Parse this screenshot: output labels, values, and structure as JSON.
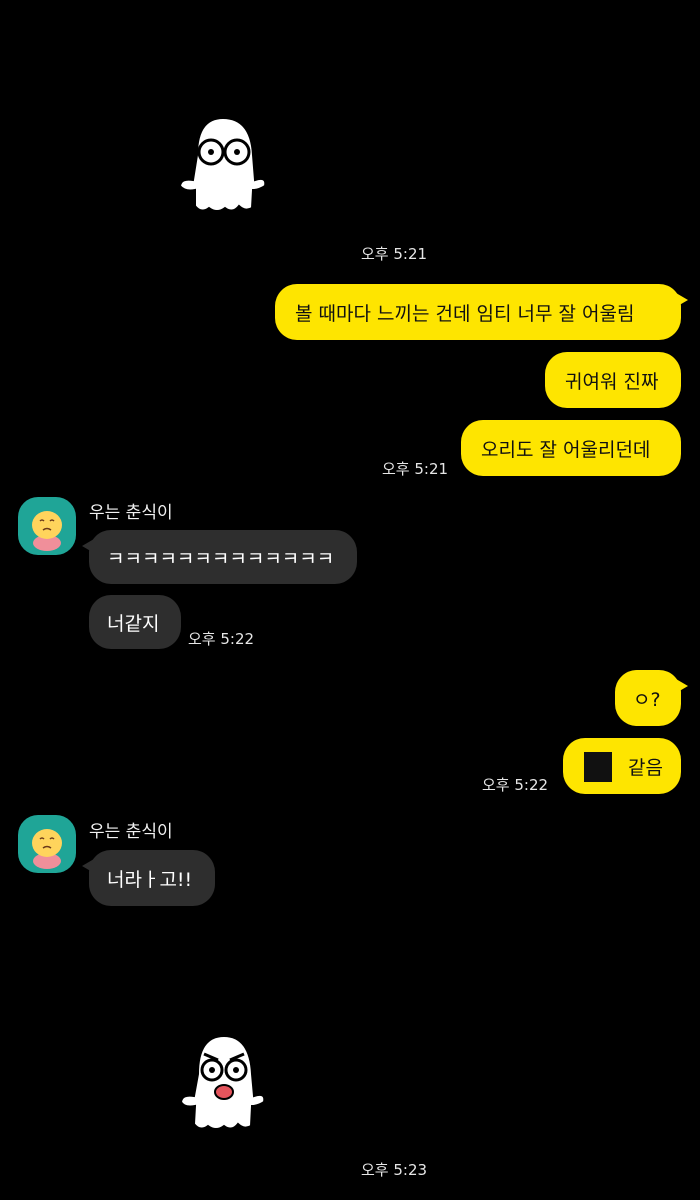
{
  "chat": {
    "contact_name": "우는 춘식이",
    "messages": [
      {
        "side": "me",
        "text": "볼 때마다 느끼는 건데 임티 너무 잘 어울림"
      },
      {
        "side": "me",
        "text": "귀여워 진짜"
      },
      {
        "side": "me",
        "text": "오리도 잘 어울리던데"
      },
      {
        "side": "them",
        "text": "ㅋㅋㅋㅋㅋㅋㅋㅋㅋㅋㅋㅋㅋ"
      },
      {
        "side": "them",
        "text": "너같지"
      },
      {
        "side": "me",
        "text": "ㅇ?"
      },
      {
        "side": "me",
        "text": "같음"
      },
      {
        "side": "them",
        "text": "너라ㅏ고!!"
      }
    ],
    "timestamps": {
      "t1": "오후 5:21",
      "t2": "오후 5:21",
      "t3": "오후 5:22",
      "t4": "오후 5:22",
      "t5": "오후 5:23"
    }
  },
  "icons": {
    "sticker_top": "ghost-sticker-icon",
    "sticker_bottom": "shocked-ghost-sticker-icon",
    "avatar": "choonsik-avatar-icon"
  },
  "colors": {
    "background": "#000000",
    "my_bubble": "#fee500",
    "their_bubble": "#2e2e2e",
    "avatar_bg": "#1fa597"
  }
}
